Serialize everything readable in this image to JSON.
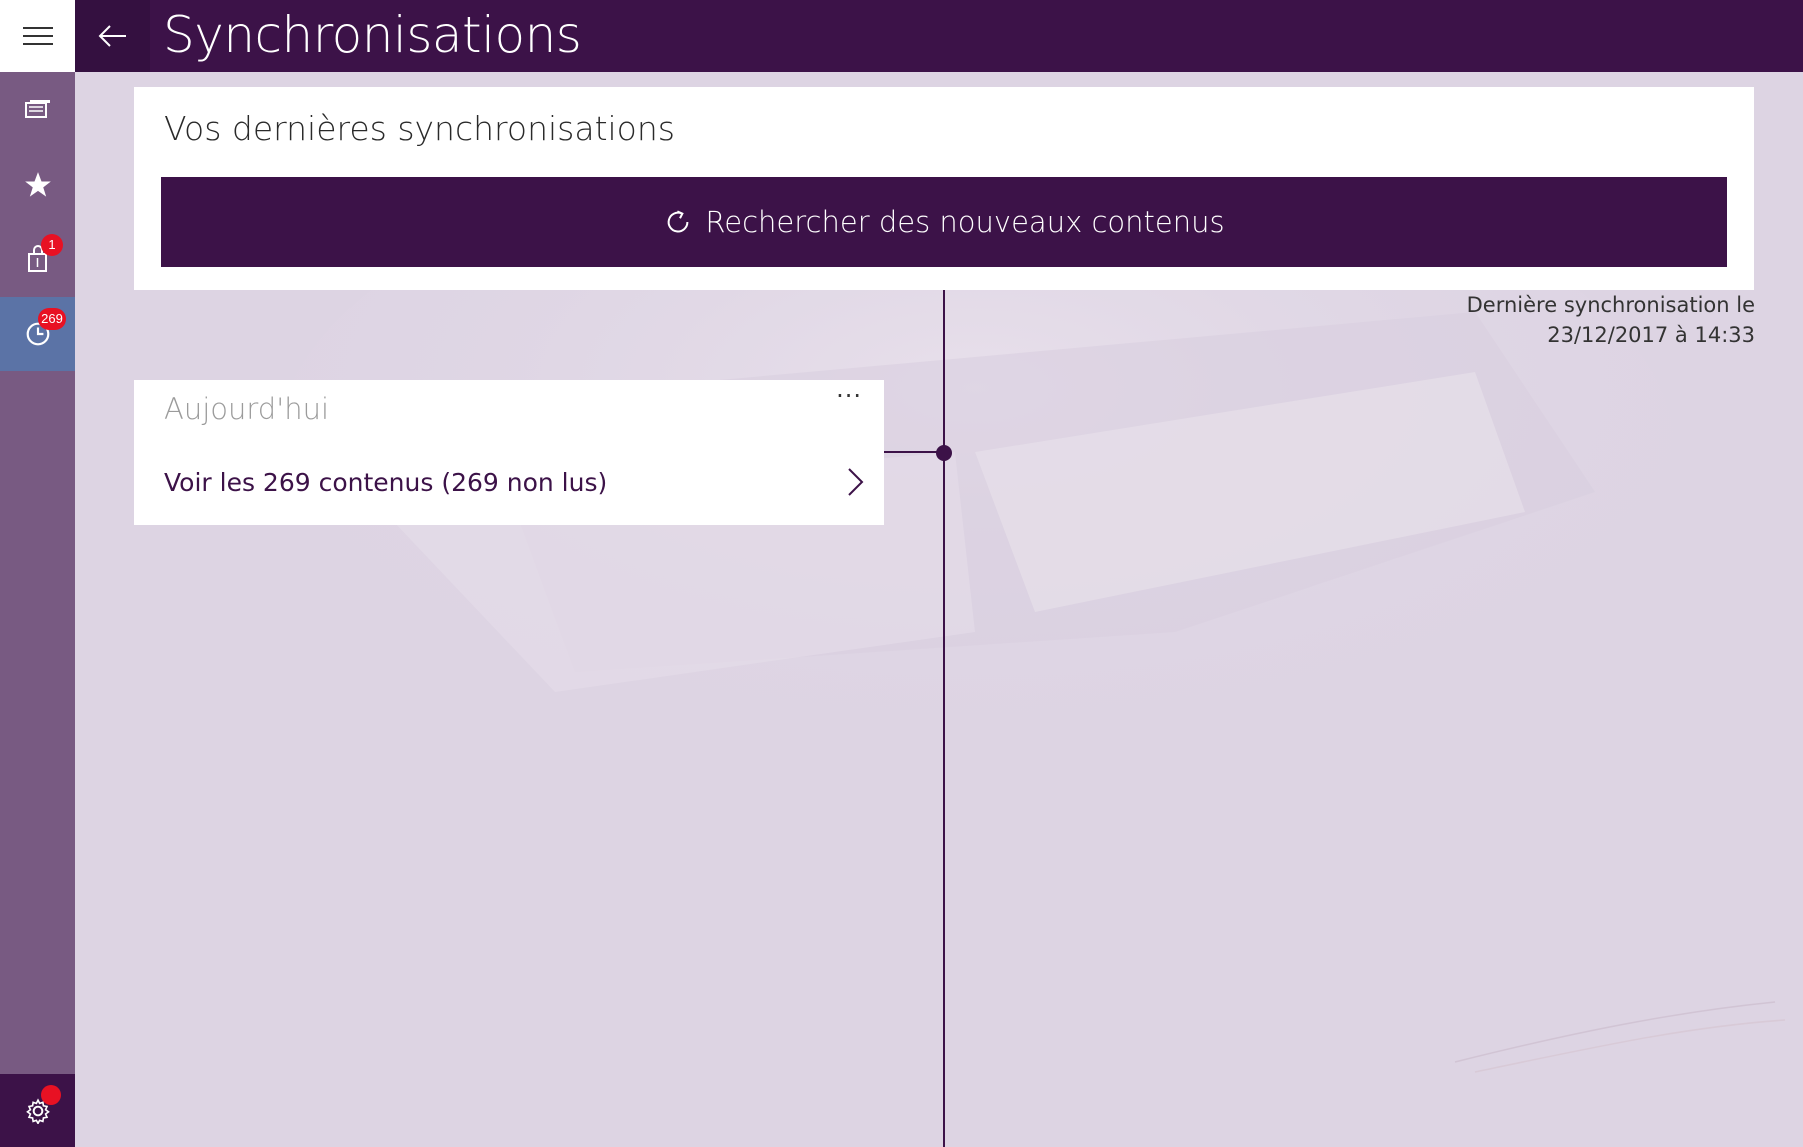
{
  "header": {
    "title": "Synchronisations"
  },
  "rail": {
    "items": [
      {
        "icon": "library-icon"
      },
      {
        "icon": "star-icon"
      },
      {
        "icon": "bag-icon",
        "badge": "1"
      },
      {
        "icon": "history-icon",
        "badge": "269",
        "active": true
      }
    ],
    "settings": {
      "icon": "gear-icon"
    }
  },
  "sync_card": {
    "heading": "Vos dernières synchronisations",
    "search_button_label": "Rechercher des nouveaux contenus"
  },
  "last_sync": {
    "line1": "Dernière synchronisation le",
    "line2": "23/12/2017 à 14:33"
  },
  "today_card": {
    "title": "Aujourd'hui",
    "more_label": "···",
    "row_label": "Voir les 269 contenus (269 non lus)"
  },
  "colors": {
    "primary": "#3c1248",
    "rail": "#785a82",
    "rail_active": "#5b73a6",
    "badge": "#e81123",
    "background": "#ddd4e3"
  }
}
